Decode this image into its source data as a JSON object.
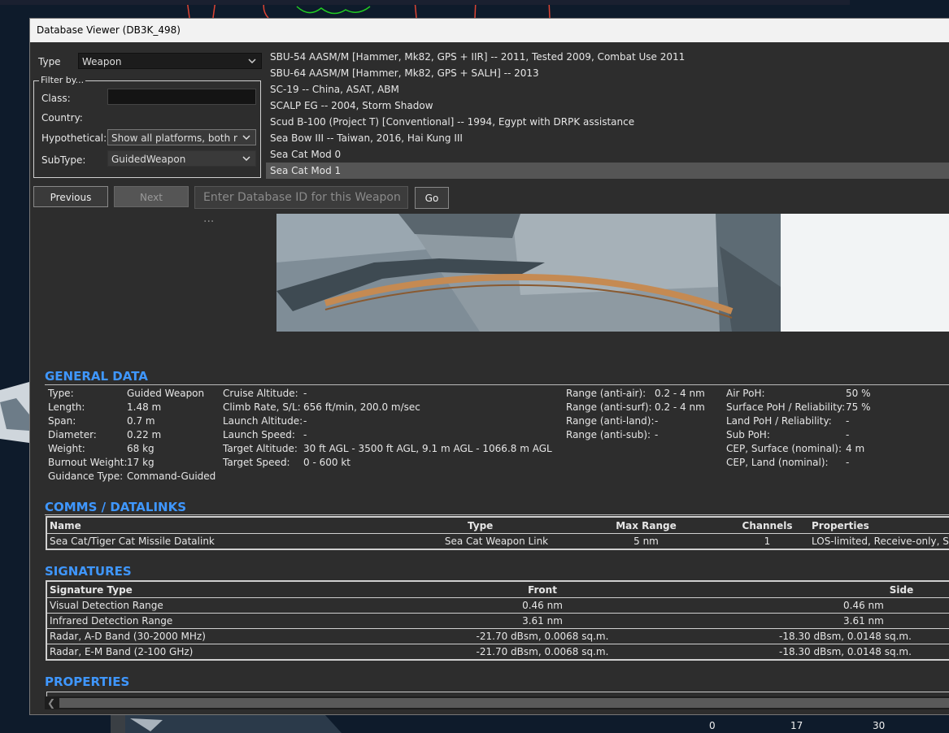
{
  "window": {
    "title": "Database Viewer (DB3K_498)"
  },
  "filters": {
    "type_label": "Type",
    "type_value": "Weapon",
    "filter_by_label": "Filter by...",
    "class_label": "Class:",
    "country_label": "Country:",
    "hypothetical_label": "Hypothetical:",
    "hypothetical_value": "Show all platforms, both real",
    "subtype_label": "SubType:",
    "subtype_value": "GuidedWeapon"
  },
  "weapon_list": [
    "SBU-54 AASM/M [Hammer, Mk82, GPS + IIR] -- 2011, Tested 2009, Combat Use 2011",
    "SBU-64 AASM/M [Hammer, Mk82, GPS + SALH] -- 2013",
    "SC-19 -- China, ASAT, ABM",
    "SCALP EG -- 2004, Storm Shadow",
    "Scud B-100 (Project T) [Conventional] -- 1994, Egypt with DRPK assistance",
    "Sea Bow III -- Taiwan, 2016, Hai Kung III",
    "Sea Cat Mod 0",
    "Sea Cat Mod 1"
  ],
  "nav": {
    "previous_label": "Previous",
    "next_label": "Next",
    "id_placeholder": "Enter Database ID for this Weapon ...",
    "go_label": "Go"
  },
  "general_data": {
    "title": "GENERAL DATA",
    "col1": [
      {
        "k": "Type:",
        "v": "Guided Weapon"
      },
      {
        "k": "Length:",
        "v": "1.48 m"
      },
      {
        "k": "Span:",
        "v": "0.7 m"
      },
      {
        "k": "Diameter:",
        "v": "0.22 m"
      },
      {
        "k": "Weight:",
        "v": "68 kg"
      },
      {
        "k": "Burnout Weight:",
        "v": "17 kg"
      },
      {
        "k": "Guidance Type:",
        "v": "Command-Guided"
      }
    ],
    "col2": [
      {
        "k": "Cruise Altitude:",
        "v": "-"
      },
      {
        "k": "Climb Rate, S/L:",
        "v": "656 ft/min, 200.0 m/sec"
      },
      {
        "k": "Launch Altitude:",
        "v": "-"
      },
      {
        "k": "Launch Speed:",
        "v": "-"
      },
      {
        "k": "Target Altitude:",
        "v": "30 ft AGL - 3500 ft AGL, 9.1 m AGL - 1066.8 m AGL"
      },
      {
        "k": "Target Speed:",
        "v": "0 - 600 kt"
      }
    ],
    "col3": [
      {
        "k": "Range (anti-air):",
        "v": "0.2 - 4 nm"
      },
      {
        "k": "Range (anti-surf):",
        "v": "0.2 - 4 nm"
      },
      {
        "k": "Range (anti-land):",
        "v": "-"
      },
      {
        "k": "Range (anti-sub):",
        "v": "-"
      }
    ],
    "col4": [
      {
        "k": "Air PoH:",
        "v": "50 %"
      },
      {
        "k": "Surface PoH / Reliability:",
        "v": "75 %"
      },
      {
        "k": "Land PoH / Reliability:",
        "v": "-"
      },
      {
        "k": "Sub PoH:",
        "v": "-"
      },
      {
        "k": "CEP, Surface (nominal):",
        "v": "4 m"
      },
      {
        "k": "CEP, Land (nominal):",
        "v": "-"
      }
    ]
  },
  "comms": {
    "title": "COMMS / DATALINKS",
    "headers": [
      "Name",
      "Type",
      "Max Range",
      "Channels",
      "Properties"
    ],
    "rows": [
      [
        "Sea Cat/Tiger Cat Missile Datalink",
        "Sea Cat Weapon Link",
        "5 nm",
        "1",
        "LOS-limited, Receive-only, Se"
      ]
    ]
  },
  "signatures": {
    "title": "SIGNATURES",
    "headers": [
      "Signature Type",
      "Front",
      "Side"
    ],
    "rows": [
      [
        "Visual Detection Range",
        "0.46 nm",
        "0.46 nm"
      ],
      [
        "Infrared Detection Range",
        "3.61 nm",
        "3.61 nm"
      ],
      [
        "Radar, A-D Band (30-2000 MHz)",
        "-21.70 dBsm, 0.0068 sq.m.",
        "-18.30 dBsm, 0.0148 sq.m."
      ],
      [
        "Radar, E-M Band (2-100 GHz)",
        "-21.70 dBsm, 0.0068 sq.m.",
        "-18.30 dBsm, 0.0148 sq.m."
      ]
    ]
  },
  "properties": {
    "title": "PROPERTIES"
  },
  "map_scale": [
    "0",
    "17",
    "30"
  ]
}
